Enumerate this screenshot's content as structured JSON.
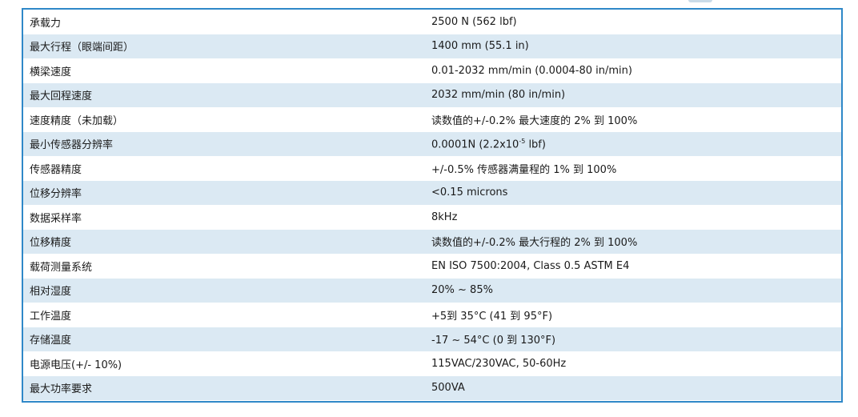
{
  "table": {
    "rows": [
      {
        "label": "承载力",
        "value": "2500 N (562 lbf)"
      },
      {
        "label": "最大行程（眼端间距）",
        "value": "1400 mm (55.1 in)"
      },
      {
        "label": "横梁速度",
        "value": "0.01-2032 mm/min (0.0004-80 in/min)"
      },
      {
        "label": "最大回程速度",
        "value": "2032 mm/min (80 in/min)"
      },
      {
        "label": "速度精度（未加载）",
        "value": "读数值的+/-0.2% 最大速度的 2%  到 100%"
      },
      {
        "label": "最小传感器分辨率",
        "value_pre": "0.0001N (2.2x10",
        "value_sup": "-5",
        "value_post": " lbf)"
      },
      {
        "label": "传感器精度",
        "value": "+/-0.5% 传感器满量程的 1% 到 100%"
      },
      {
        "label": "位移分辨率",
        "value": "<0.15 microns"
      },
      {
        "label": "数据采样率",
        "value": "8kHz"
      },
      {
        "label": "位移精度",
        "value": "读数值的+/-0.2%  最大行程的 2%  到 100%"
      },
      {
        "label": "载荷测量系统",
        "value": "EN ISO 7500:2004, Class 0.5 ASTM E4"
      },
      {
        "label": "相对湿度",
        "value": "20% ~ 85%"
      },
      {
        "label": "工作温度",
        "value": "+5到 35°C (41 到 95°F)"
      },
      {
        "label": "存储温度",
        "value": "-17 ~ 54°C (0 到 130°F)"
      },
      {
        "label": "电源电压(+/- 10%)",
        "value": "115VAC/230VAC, 50-60Hz"
      },
      {
        "label": "最大功率要求",
        "value": "500VA"
      }
    ]
  },
  "colors": {
    "border": "#2f88c8",
    "alt_row": "#dbe9f3"
  }
}
